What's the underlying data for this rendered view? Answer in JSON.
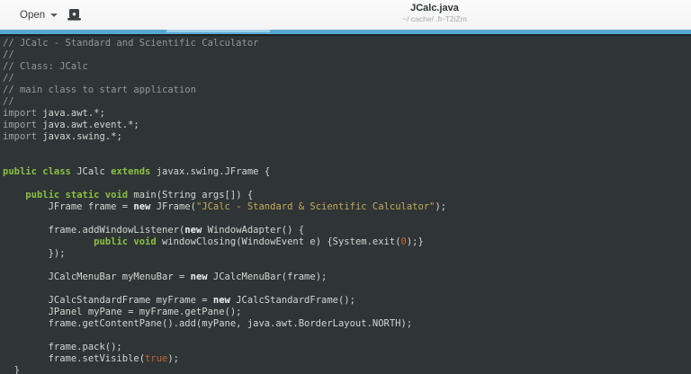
{
  "header": {
    "open_label": "Open",
    "title": "JCalc.java",
    "subtitle": "~/ cache/ .fr-T2iZm"
  },
  "colors": {
    "header_bg": "#f7f7f7",
    "progress_bar": "#58a6d3",
    "progress_highlight": "#9ed0e8",
    "editor_bg": "#2f3437",
    "text_default": "#d3d7cf",
    "text_comment": "#949892",
    "text_keyword": "#8ac13f",
    "text_string": "#c6ab55",
    "text_number": "#c2662d"
  },
  "editor": {
    "language": "java",
    "lines": [
      [
        {
          "c": "cm",
          "t": "// JCalc - Standard and Scientific Calculator"
        }
      ],
      [
        {
          "c": "cm",
          "t": "//"
        }
      ],
      [
        {
          "c": "cm",
          "t": "// Class: JCalc"
        }
      ],
      [
        {
          "c": "cm",
          "t": "//"
        }
      ],
      [
        {
          "c": "cm",
          "t": "// main class to start application"
        }
      ],
      [
        {
          "c": "cm",
          "t": "//"
        }
      ],
      [
        {
          "c": "im",
          "t": "import "
        },
        {
          "c": "pl",
          "t": "java.awt.*;"
        }
      ],
      [
        {
          "c": "im",
          "t": "import "
        },
        {
          "c": "pl",
          "t": "java.awt.event.*;"
        }
      ],
      [
        {
          "c": "im",
          "t": "import "
        },
        {
          "c": "pl",
          "t": "javax.swing.*;"
        }
      ],
      [],
      [],
      [
        {
          "c": "kw",
          "t": "public class "
        },
        {
          "c": "pl",
          "t": "JCalc "
        },
        {
          "c": "kw",
          "t": "extends"
        },
        {
          "c": "pl",
          "t": " javax.swing.JFrame {"
        }
      ],
      [],
      [
        {
          "c": "pl",
          "t": "    "
        },
        {
          "c": "kw",
          "t": "public static void "
        },
        {
          "c": "pl",
          "t": "main(String args[]) {"
        }
      ],
      [
        {
          "c": "pl",
          "t": "        JFrame frame = "
        },
        {
          "c": "nw",
          "t": "new"
        },
        {
          "c": "pl",
          "t": " JFrame("
        },
        {
          "c": "st",
          "t": "\"JCalc - Standard & Scientific Calculator\""
        },
        {
          "c": "pl",
          "t": ");"
        }
      ],
      [],
      [
        {
          "c": "pl",
          "t": "        frame.addWindowListener("
        },
        {
          "c": "nw",
          "t": "new"
        },
        {
          "c": "pl",
          "t": " WindowAdapter() {"
        }
      ],
      [
        {
          "c": "pl",
          "t": "                "
        },
        {
          "c": "kw",
          "t": "public void "
        },
        {
          "c": "pl",
          "t": "windowClosing(WindowEvent e) {System.exit("
        },
        {
          "c": "num",
          "t": "0"
        },
        {
          "c": "pl",
          "t": ");}"
        }
      ],
      [
        {
          "c": "pl",
          "t": "        });"
        }
      ],
      [],
      [
        {
          "c": "pl",
          "t": "        JCalcMenuBar myMenuBar = "
        },
        {
          "c": "nw",
          "t": "new"
        },
        {
          "c": "pl",
          "t": " JCalcMenuBar(frame);"
        }
      ],
      [],
      [
        {
          "c": "pl",
          "t": "        JCalcStandardFrame myFrame = "
        },
        {
          "c": "nw",
          "t": "new"
        },
        {
          "c": "pl",
          "t": " JCalcStandardFrame();"
        }
      ],
      [
        {
          "c": "pl",
          "t": "        JPanel myPane = myFrame.getPane();"
        }
      ],
      [
        {
          "c": "pl",
          "t": "        frame.getContentPane().add(myPane, java.awt.BorderLayout.NORTH);"
        }
      ],
      [],
      [
        {
          "c": "pl",
          "t": "        frame.pack();"
        }
      ],
      [
        {
          "c": "pl",
          "t": "        frame.setVisible("
        },
        {
          "c": "num",
          "t": "true"
        },
        {
          "c": "pl",
          "t": ");"
        }
      ],
      [
        {
          "c": "pl",
          "t": "  }"
        }
      ]
    ]
  }
}
